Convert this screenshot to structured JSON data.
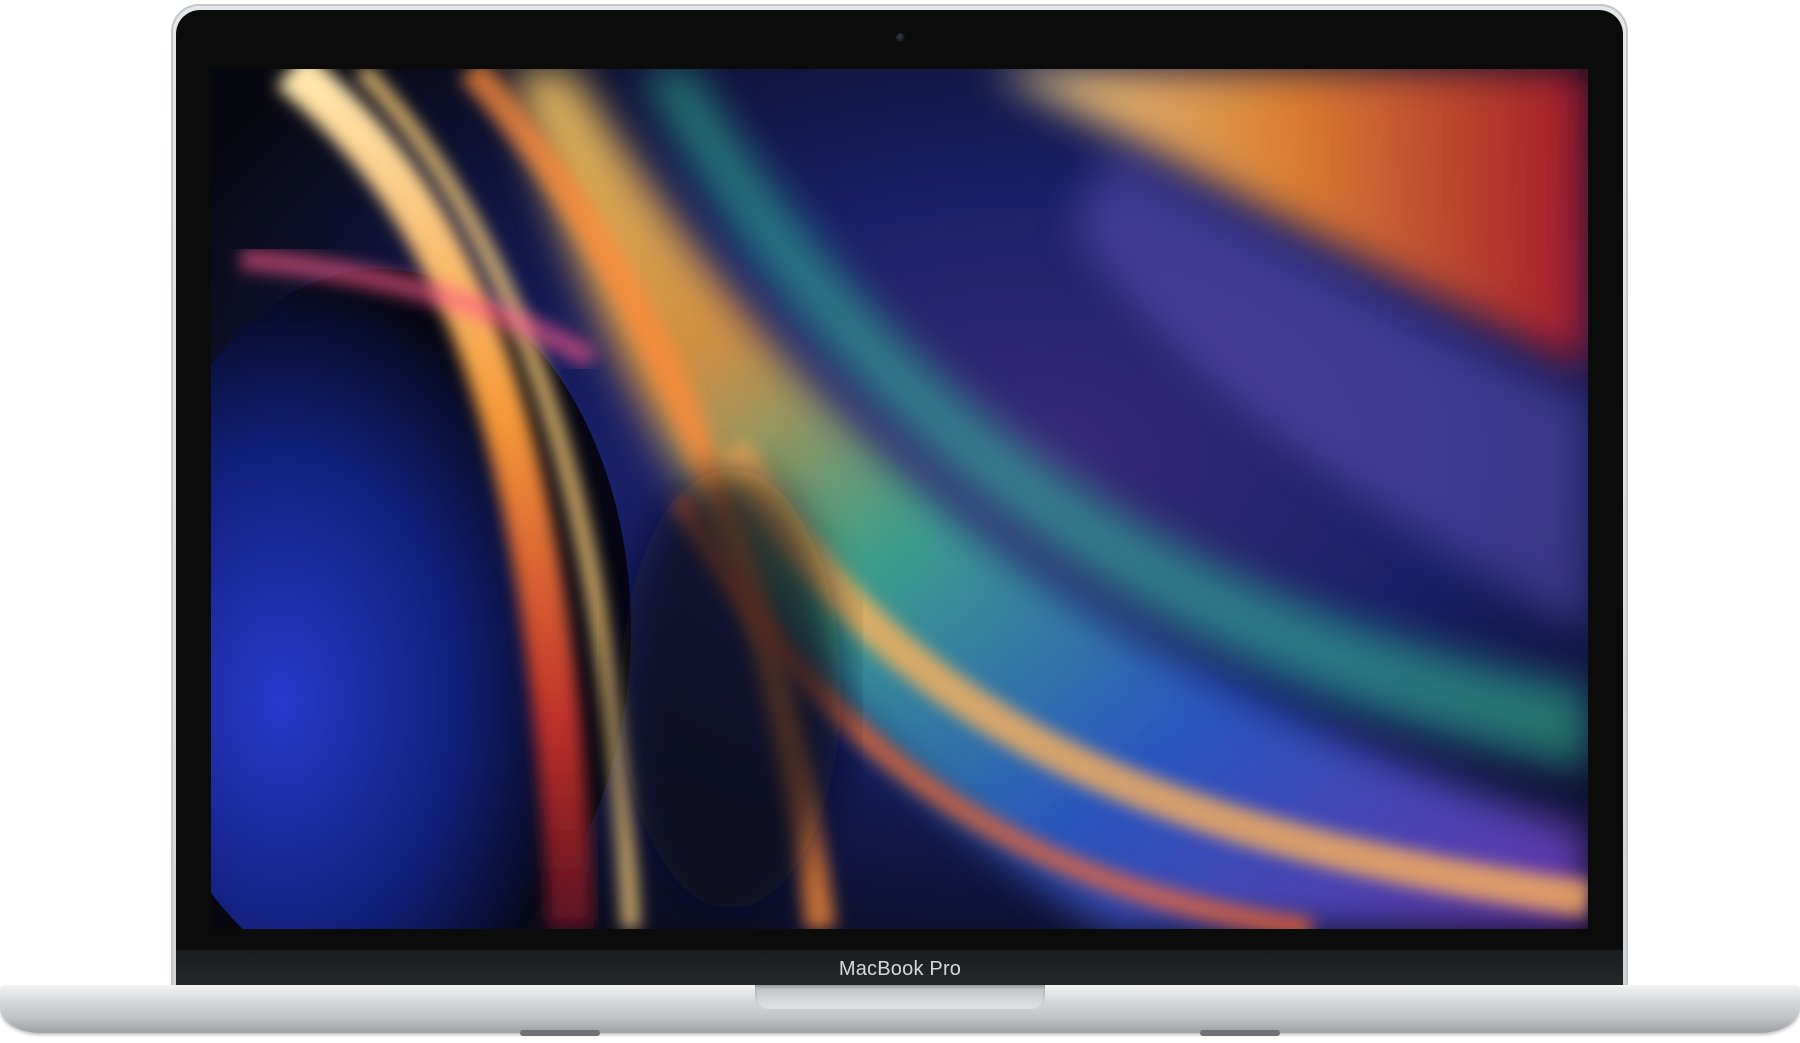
{
  "device": {
    "model_label": "MacBook Pro"
  },
  "colors": {
    "aluminum": "#d2d4d7",
    "bezel": "#0b0b0c",
    "label_text": "#d8d8da"
  },
  "wallpaper": {
    "icon": "abstract-color-arcs-wallpaper"
  }
}
